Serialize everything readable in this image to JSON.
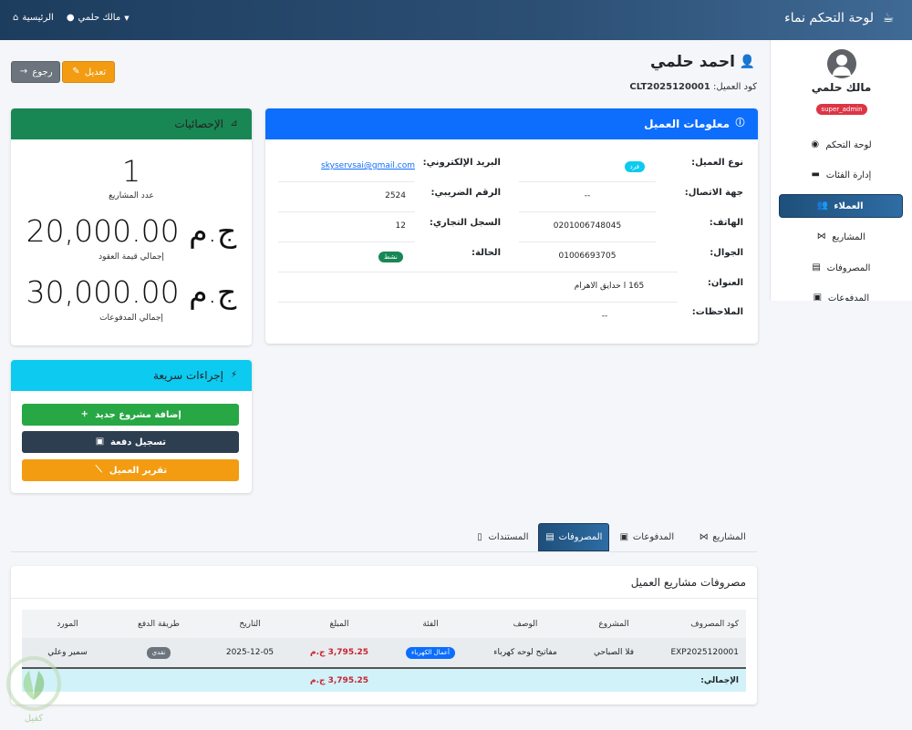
{
  "topbar": {
    "brand": "لوحة التحكم نماء",
    "home": "الرئيسية",
    "user": "مالك حلمي"
  },
  "sidebar": {
    "user_name": "مالك حلمي",
    "role": "super_admin",
    "items": [
      {
        "label": "لوحة التحكم",
        "icon": "dashboard-icon"
      },
      {
        "label": "إدارة الفئات",
        "icon": "folder-icon"
      },
      {
        "label": "العملاء",
        "icon": "users-icon"
      },
      {
        "label": "المشاريع",
        "icon": "projects-icon"
      },
      {
        "label": "المصروفات",
        "icon": "expenses-icon"
      },
      {
        "label": "المدفوعات",
        "icon": "payments-icon"
      }
    ]
  },
  "header": {
    "title": "احمد حلمي",
    "code_label": "كود العميل:",
    "code_value": "CLT2025120001",
    "edit": "تعديل",
    "back": "رجوع"
  },
  "client_info": {
    "title": "معلومات العميل",
    "type_label": "نوع العميل:",
    "type_value": "فرد",
    "contact_label": "جهة الاتصال:",
    "contact_value": "--",
    "phone_label": "الهاتف:",
    "phone_value": "0201006748045",
    "mobile_label": "الجوال:",
    "mobile_value": "01006693705",
    "address_label": "العنوان:",
    "address_value": "165 ا حدايق الاهرام",
    "notes_label": "الملاحظات:",
    "notes_value": "--",
    "email_label": "البريد الإلكتروني:",
    "email_value": "skyservsai@gmail.com",
    "tax_label": "الرقم الضريبي:",
    "tax_value": "2524",
    "cr_label": "السجل التجاري:",
    "cr_value": "12",
    "status_label": "الحالة:",
    "status_value": "نشط"
  },
  "stats": {
    "title": "الإحصائيات",
    "projects_count": "1",
    "projects_label": "عدد المشاريع",
    "contracts_value": "20,000.00 ج.م",
    "contracts_label": "إجمالي قيمة العقود",
    "payments_value": "30,000.00 ج.م",
    "payments_label": "إجمالي المدفوعات"
  },
  "quick_actions": {
    "title": "إجراءات سريعة",
    "add_project": "إضافة مشروع جديد",
    "record_payment": "تسجيل دفعة",
    "client_report": "تقرير العميل"
  },
  "tabs": [
    "المشاريع",
    "المدفوعات",
    "المصروفات",
    "المستندات"
  ],
  "expenses": {
    "title": "مصروفات مشاريع العميل",
    "columns": [
      "كود المصروف",
      "المشروع",
      "الوصف",
      "الفئة",
      "المبلغ",
      "التاريخ",
      "طريقة الدفع",
      "المورد"
    ],
    "rows": [
      {
        "code": "EXP2025120001",
        "project": "فلا الصباحي",
        "description": "مفاتيح لوحه كهرباء",
        "category": "أعمال الكهرباء",
        "amount": "3,795.25 ج.م",
        "date": "2025-12-05",
        "method": "نقدي",
        "supplier": "سمير وعلي"
      }
    ],
    "total_label": "الإجمالي:",
    "total_value": "3,795.25 ج.م"
  },
  "colors": {
    "navbar": "#2c4f74",
    "info_header": "#0d6efd",
    "stats_header": "#198754",
    "quick_header": "#0dcaf0",
    "success": "#28a745",
    "dark": "#2d3e50",
    "warning": "#f39c12",
    "danger": "#dc3545"
  },
  "logo": {
    "text": "كفيل"
  }
}
